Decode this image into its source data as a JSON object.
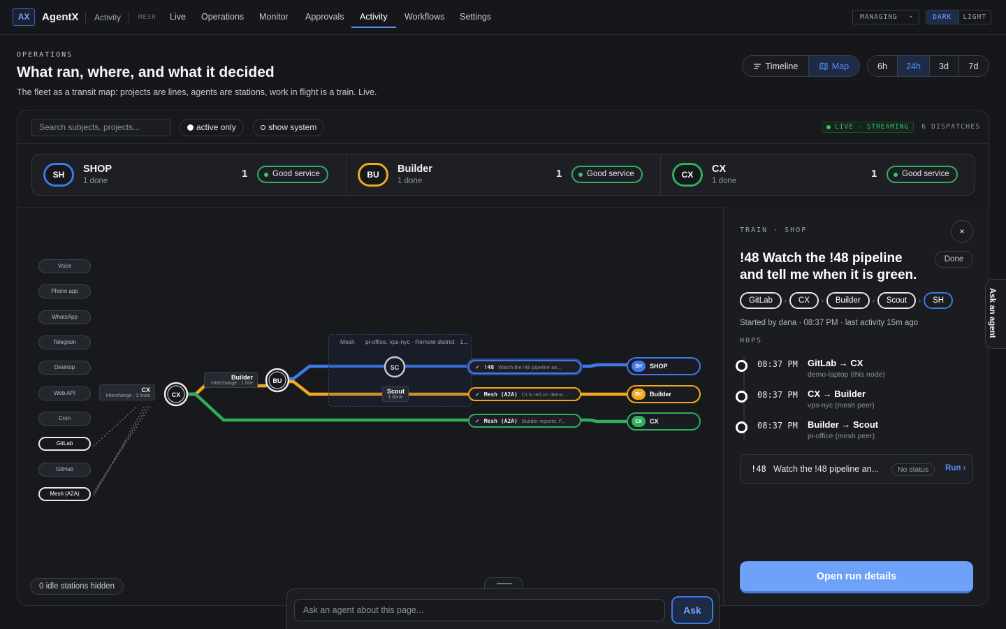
{
  "nav": {
    "logo": "AX",
    "brand": "AgentX",
    "activity_small": "Activity",
    "mesh_tag": "MESH",
    "items": [
      "Live",
      "Operations",
      "Monitor",
      "Approvals",
      "Activity",
      "Workflows",
      "Settings"
    ],
    "active_item": "Activity",
    "managing": "MANAGING",
    "managing_caret": "▾",
    "theme_dark": "DARK",
    "theme_light": "LIGHT"
  },
  "header": {
    "eyebrow": "OPERATIONS",
    "title": "What ran, where, and what it decided",
    "subtitle": "The fleet as a transit map: projects are lines, agents are stations, work in flight is a train. Live.",
    "view_toggle": [
      {
        "label": "Timeline",
        "icon": "timeline-icon",
        "active": false
      },
      {
        "label": "Map",
        "icon": "map-icon",
        "active": true
      }
    ],
    "ranges": [
      {
        "label": "6h",
        "active": false
      },
      {
        "label": "24h",
        "active": true
      },
      {
        "label": "3d",
        "active": false
      },
      {
        "label": "7d",
        "active": false
      }
    ]
  },
  "filters": {
    "search_placeholder": "Search subjects, projects...",
    "active_only": "active only",
    "show_system": "show system",
    "live": "LIVE",
    "streaming": "STREAMING",
    "dispatches": "6 DISPATCHES"
  },
  "lines": [
    {
      "code": "SH",
      "name": "SHOP",
      "done": "1 done",
      "count": "1",
      "status": "Good service",
      "color": "#3f78e8"
    },
    {
      "code": "BU",
      "name": "Builder",
      "done": "1 done",
      "count": "1",
      "status": "Good service",
      "color": "#f2a91d"
    },
    {
      "code": "CX",
      "name": "CX",
      "done": "1 done",
      "count": "1",
      "status": "Good service",
      "color": "#2fae5d"
    }
  ],
  "map": {
    "sources": [
      "Voice",
      "Phone app",
      "WhatsApp",
      "Telegram",
      "Desktop",
      "Web API",
      "Cron",
      "GitLab",
      "GitHub",
      "Mesh (A2A)"
    ],
    "highlighted_sources": [
      "GitLab",
      "Mesh (A2A)"
    ],
    "mesh_label": "Mesh",
    "mesh_sub": "pi-office, vps-nyc · Remote district · 1...",
    "interchange_cx": {
      "name": "CX",
      "sub": "Interchange · 2 lines"
    },
    "interchange_builder": {
      "name": "Builder",
      "sub": "Interchange · 1 line"
    },
    "station_cx": "CX",
    "station_bu": "BU",
    "station_sc": "SC",
    "scout": {
      "name": "Scout",
      "sub": "1 done"
    },
    "trains": [
      {
        "key": "!48",
        "desc": "Watch the !48 pipeline an...",
        "color": "#3f78e8"
      },
      {
        "key": "Mesh (A2A)",
        "desc": "CI is red on demo...",
        "color": "#f2a91d"
      },
      {
        "key": "Mesh (A2A)",
        "desc": "Builder reports: F...",
        "color": "#2fae5d"
      }
    ],
    "termini": [
      {
        "code": "SH",
        "name": "SHOP",
        "color": "#3f78e8"
      },
      {
        "code": "BU",
        "name": "Builder",
        "color": "#f2a91d"
      },
      {
        "code": "CX",
        "name": "CX",
        "color": "#2fae5d"
      }
    ],
    "idle_hidden": "0 idle stations hidden"
  },
  "detail": {
    "eyebrow": "TRAIN · SHOP",
    "close": "×",
    "title": "!48 Watch the !48 pipeline and tell me when it is green.",
    "status": "Done",
    "route": [
      "GitLab",
      "CX",
      "Builder",
      "Scout",
      "SH"
    ],
    "route_sep": "›",
    "started": "Started by dana · 08:37 PM · last activity 15m ago",
    "hops_label": "HOPS",
    "hops": [
      {
        "time": "08:37 PM",
        "title": "GitLab → CX",
        "host": "demo-laptop (this node)"
      },
      {
        "time": "08:37 PM",
        "title": "CX → Builder",
        "host": "vps-nyc (mesh peer)"
      },
      {
        "time": "08:37 PM",
        "title": "Builder → Scout",
        "host": "pi-office (mesh peer)"
      }
    ],
    "run": {
      "id": "!48",
      "title": "Watch the !48 pipeline an...",
      "status": "No status",
      "action": "Run ›"
    },
    "open_button": "Open run details"
  },
  "ask": {
    "side_tab": "Ask an agent",
    "placeholder": "Ask an agent about this page...",
    "button": "Ask"
  }
}
